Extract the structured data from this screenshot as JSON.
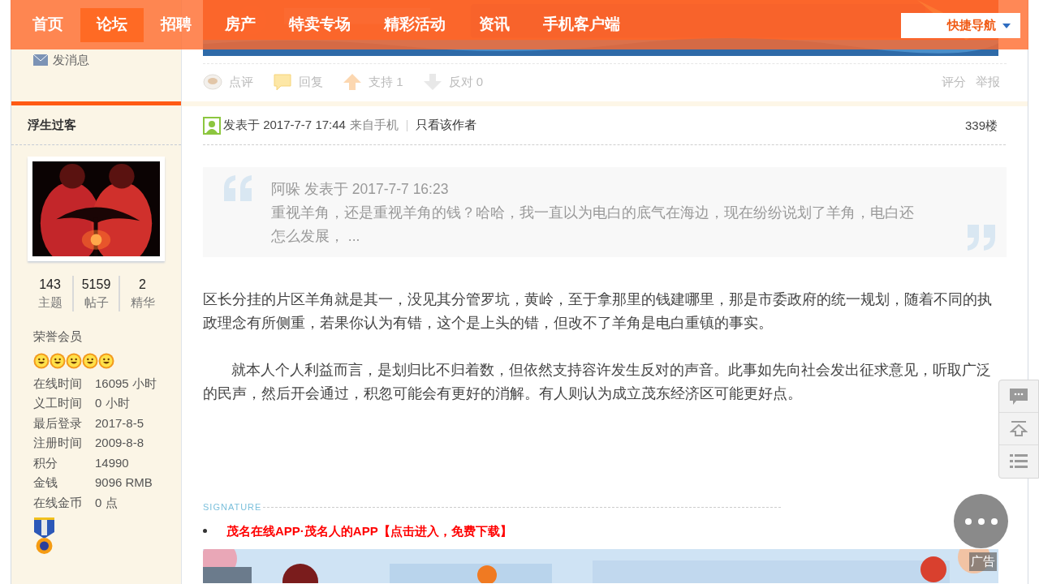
{
  "nav": {
    "items": [
      {
        "label": "首页",
        "selected": false
      },
      {
        "label": "论坛",
        "selected": true
      },
      {
        "label": "招聘",
        "selected": false
      },
      {
        "label": "房产",
        "selected": false
      },
      {
        "label": "特卖专场",
        "selected": false
      },
      {
        "label": "精彩活动",
        "selected": false
      },
      {
        "label": "资讯",
        "selected": false
      },
      {
        "label": "手机客户端",
        "selected": false
      }
    ],
    "quick_nav": "快捷导航"
  },
  "previous_post": {
    "message_link": "发消息",
    "actions": [
      {
        "kind": "comment",
        "label": "点评"
      },
      {
        "kind": "reply",
        "label": "回复"
      },
      {
        "kind": "up",
        "label": "支持 1"
      },
      {
        "kind": "down",
        "label": "反对 0"
      }
    ],
    "right_actions": [
      "评分",
      "举报"
    ]
  },
  "post": {
    "author": "浮生过客",
    "stats": [
      {
        "value": "143",
        "label": "主题"
      },
      {
        "value": "5159",
        "label": "帖子"
      },
      {
        "value": "2",
        "label": "精华"
      }
    ],
    "rank": "荣誉会员",
    "stars": 5,
    "details": [
      {
        "label": "在线时间",
        "value": "16095 小时"
      },
      {
        "label": "义工时间",
        "value": "0 小时"
      },
      {
        "label": "最后登录",
        "value": "2017-8-5"
      },
      {
        "label": "注册时间",
        "value": "2009-8-8"
      },
      {
        "label": "积分",
        "value": "14990"
      },
      {
        "label": "金钱",
        "value": "9096 RMB"
      },
      {
        "label": "在线金币",
        "value": "0 点"
      }
    ],
    "posted": "发表于 2017-7-7 17:44",
    "source": "来自手机",
    "author_only": "只看该作者",
    "floor": "339楼",
    "quote": {
      "header": "阿哚 发表于 2017-7-7 16:23",
      "text": "重视羊角，还是重视羊角的钱？哈哈，我一直以为电白的底气在海边，现在纷纷说划了羊角，电白还怎么发展， ..."
    },
    "paragraphs": [
      {
        "indent": false,
        "text": "区长分挂的片区羊角就是其一，没见其分管罗坑，黄岭，至于拿那里的钱建哪里，那是市委政府的统一规划，随着不同的执政理念有所侧重，若果你认为有错，这个是上头的错，但改不了羊角是电白重镇的事实。"
      },
      {
        "indent": true,
        "text": "就本人个人利益而言，是划归比不归着数，但依然支持容许发生反对的声音。此事如先向社会发出征求意见，听取广泛的民声，然后开会通过，积忽可能会有更好的消解。有人则认为成立茂东经济区可能更好点。"
      }
    ],
    "signature_label": "SIGNATURE",
    "signature_link": "茂名在线APP·茂名人的APP【点击进入，免费下载】",
    "ad_label": "广告"
  }
}
